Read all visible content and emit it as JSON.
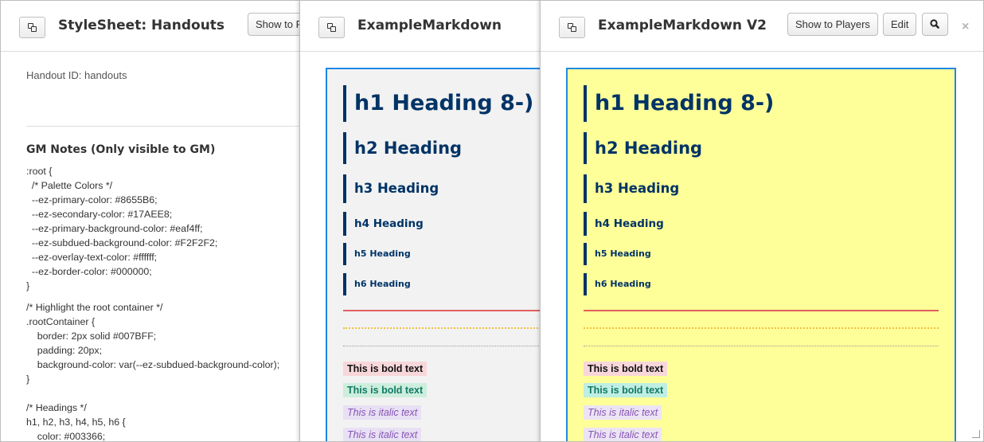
{
  "window1": {
    "title": "StyleSheet: Handouts",
    "show_button": "Show to P",
    "handout_id": "Handout ID: handouts",
    "gm_notes_title": "GM Notes (Only visible to GM)",
    "code_lines": [
      ":root {",
      "  /* Palette Colors */",
      "  --ez-primary-color: #8655B6;",
      "  --ez-secondary-color: #17AEE8;",
      "  --ez-primary-background-color: #eaf4ff;",
      "  --ez-subdued-background-color: #F2F2F2;",
      "  --ez-overlay-text-color: #ffffff;",
      "  --ez-border-color: #000000;",
      "}",
      "",
      "/* Highlight the root container */",
      ".rootContainer {",
      "    border: 2px solid #007BFF;",
      "    padding: 20px;",
      "    background-color: var(--ez-subdued-background-color);",
      "}",
      " ",
      "/* Headings */",
      "h1, h2, h3, h4, h5, h6 {",
      "    color: #003366;"
    ]
  },
  "window2": {
    "title": "ExampleMarkdown",
    "h1": "h1 Heading 8-)",
    "h2": "h2 Heading",
    "h3": "h3 Heading",
    "h4": "h4 Heading",
    "h5": "h5 Heading",
    "h6": "h6 Heading",
    "bold1": "This is bold text",
    "bold2": "This is bold text",
    "italic1": "This is italic text",
    "italic2": "This is italic text"
  },
  "window3": {
    "title": "ExampleMarkdown V2",
    "show_button": "Show to Players",
    "edit_button": "Edit",
    "close": "×",
    "h1": "h1 Heading 8-)",
    "h2": "h2 Heading",
    "h3": "h3 Heading",
    "h4": "h4 Heading",
    "h5": "h5 Heading",
    "h6": "h6 Heading",
    "bold1": "This is bold text",
    "bold2": "This is bold text",
    "italic1": "This is italic text",
    "italic2": "This is italic text"
  },
  "icons": {
    "popout": "popout-icon",
    "search": "search-icon",
    "close": "close-icon"
  },
  "colors": {
    "heading": "#003366",
    "panel_border": "#1E88E5",
    "panel2_bg": "#F2F2F2",
    "panel3_bg": "#FFFF99",
    "italic": "#8655B6"
  }
}
